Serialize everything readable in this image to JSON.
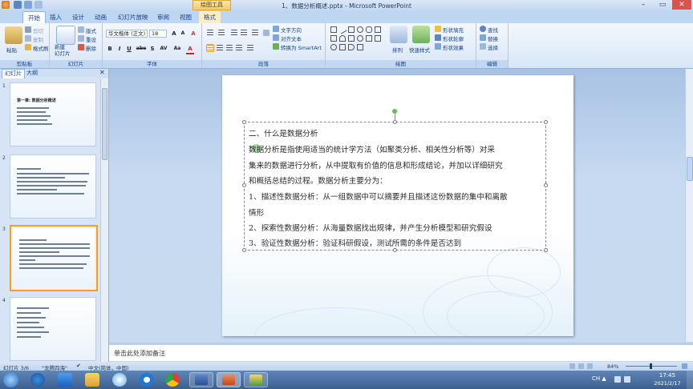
{
  "window": {
    "title": "1、数据分析概述.pptx - Microsoft PowerPoint",
    "context_tab": "绘图工具"
  },
  "tabs": [
    "开始",
    "插入",
    "设计",
    "动画",
    "幻灯片放映",
    "审阅",
    "视图",
    "格式"
  ],
  "ribbon": {
    "clipboard": {
      "label": "剪贴板",
      "paste": "粘贴",
      "cut": "剪切",
      "copy": "复制",
      "format_painter": "格式刷"
    },
    "slides": {
      "label": "幻灯片",
      "new_slide": "新建\n幻灯片",
      "layout": "版式",
      "reset": "重设",
      "delete": "删除"
    },
    "font": {
      "label": "字体",
      "font_name": "华文楷体 (正文)",
      "font_size": "18",
      "grow": "A",
      "shrink": "A",
      "clear": "A",
      "bold": "B",
      "italic": "I",
      "underline": "U",
      "strike": "abe",
      "shadow": "S",
      "spacing": "AV",
      "case": "Aa",
      "color": "A"
    },
    "paragraph": {
      "label": "段落",
      "text_direction": "文字方向",
      "align_text": "对齐文本",
      "smartart": "转换为 SmartArt"
    },
    "drawing": {
      "label": "绘图",
      "arrange": "排列",
      "quick_styles": "快速样式",
      "shape_fill": "形状填充",
      "shape_outline": "形状轮廓",
      "shape_effects": "形状效果"
    },
    "editing": {
      "label": "编辑",
      "find": "查找",
      "replace": "替换",
      "select": "选择"
    }
  },
  "slide_pane": {
    "tabs": [
      "幻灯片",
      "大纲"
    ],
    "slides": [
      {
        "num": "1",
        "title": "第一章: 数据分析概述"
      },
      {
        "num": "2",
        "title": ""
      },
      {
        "num": "3",
        "title": ""
      },
      {
        "num": "4",
        "title": ""
      }
    ]
  },
  "slide": {
    "lines": [
      "二、什么是数据分析",
      "数据分析是指使用适当的统计学方法（如聚类分析、相关性分析等）对采",
      "集来的数据进行分析，从中提取有价值的信息和形成结论，并加以详细研究",
      "和概括总结的过程。数据分析主要分为：",
      "1、描述性数据分析：从一组数据中可以摘要并且描述这份数据的集中和离散",
      "情形",
      "2、探索性数据分析：从海量数据找出规律，并产生分析模型和研究假设",
      "3、验证性数据分析：验证科研假设，测试所需的条件是否达到"
    ]
  },
  "notes": {
    "placeholder": "单击此处添加备注"
  },
  "status": {
    "slide_info": "幻灯片 3/6",
    "theme": "\"龙腾四海\"",
    "language": "中文(简体，中国)",
    "zoom": "84%"
  },
  "taskbar": {
    "time": "17:45",
    "date": "2021/2/17"
  },
  "colors": {
    "accent": "#15428b",
    "ribbon_bg": "#d8e6f7",
    "selected_thumb": "#f0a030",
    "taskbar": "#3c5f8f"
  }
}
